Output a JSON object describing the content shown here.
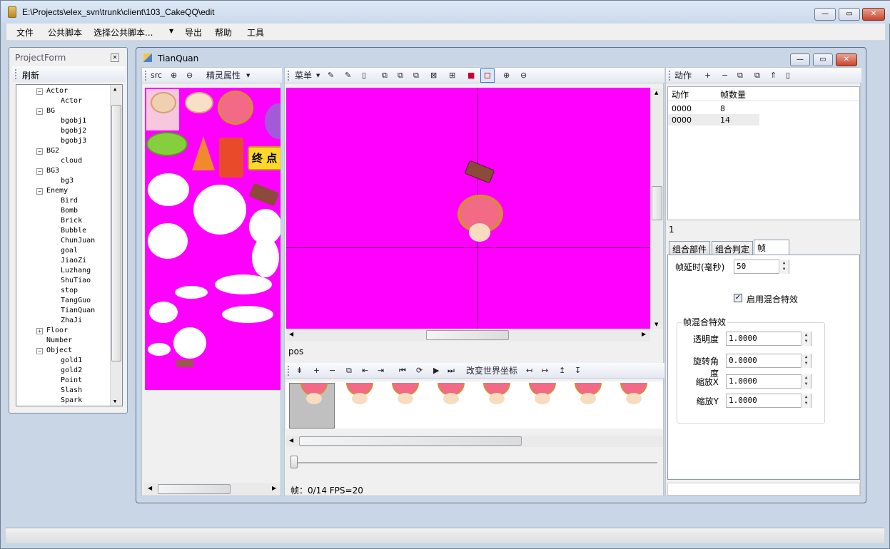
{
  "window": {
    "title": "E:\\Projects\\elex_svn\\trunk\\client\\103_CakeQQ\\edit"
  },
  "menu": {
    "items": [
      "文件",
      "公共脚本",
      "选择公共脚本...",
      "导出",
      "帮助",
      "工具"
    ]
  },
  "project": {
    "title": "ProjectForm",
    "refresh": "刷新",
    "tree": [
      {
        "label": "Actor",
        "level": 1,
        "expanded": true
      },
      {
        "label": "Actor",
        "level": 2
      },
      {
        "label": "BG",
        "level": 1,
        "expanded": true
      },
      {
        "label": "bgobj1",
        "level": 2
      },
      {
        "label": "bgobj2",
        "level": 2
      },
      {
        "label": "bgobj3",
        "level": 2
      },
      {
        "label": "BG2",
        "level": 1,
        "expanded": true
      },
      {
        "label": "cloud",
        "level": 2
      },
      {
        "label": "BG3",
        "level": 1,
        "expanded": true
      },
      {
        "label": "bg3",
        "level": 2
      },
      {
        "label": "Enemy",
        "level": 1,
        "expanded": true
      },
      {
        "label": "Bird",
        "level": 2
      },
      {
        "label": "Bomb",
        "level": 2
      },
      {
        "label": "Brick",
        "level": 2
      },
      {
        "label": "Bubble",
        "level": 2
      },
      {
        "label": "ChunJuan",
        "level": 2
      },
      {
        "label": "goal",
        "level": 2
      },
      {
        "label": "JiaoZi",
        "level": 2
      },
      {
        "label": "Luzhang",
        "level": 2
      },
      {
        "label": "ShuTiao",
        "level": 2
      },
      {
        "label": "stop",
        "level": 2
      },
      {
        "label": "TangGuo",
        "level": 2
      },
      {
        "label": "TianQuan",
        "level": 2
      },
      {
        "label": "ZhaJi",
        "level": 2
      },
      {
        "label": "Floor",
        "level": 1,
        "expanded": false
      },
      {
        "label": "Number",
        "level": 1,
        "leaf": true
      },
      {
        "label": "Object",
        "level": 1,
        "expanded": true
      },
      {
        "label": "gold1",
        "level": 2
      },
      {
        "label": "gold2",
        "level": 2
      },
      {
        "label": "Point",
        "level": 2
      },
      {
        "label": "Slash",
        "level": 2
      },
      {
        "label": "Spark",
        "level": 2
      }
    ]
  },
  "editor": {
    "title": "TianQuan",
    "src_toolbar": {
      "src": "src",
      "props": "精灵属性"
    },
    "canvas_toolbar": {
      "menu": "菜单"
    },
    "pos_label": "pos",
    "frame_toolbar": {
      "world_coord": "改变世界坐标"
    },
    "status": "帧：0/14 FPS=20"
  },
  "actions": {
    "toolbar_label": "动作",
    "columns": [
      "动作",
      "帧数量"
    ],
    "rows": [
      [
        "0000",
        "8"
      ],
      [
        "0000",
        "14"
      ]
    ],
    "footer": "1"
  },
  "props": {
    "tabs": [
      "组合部件",
      "组合判定",
      "帧"
    ],
    "delay_label": "帧延时(毫秒)",
    "delay_value": "50",
    "blend_checkbox": "启用混合特效",
    "group_title": "帧混合特效",
    "fields": [
      {
        "label": "透明度",
        "value": "1.0000"
      },
      {
        "label": "旋转角度",
        "value": "0.0000"
      },
      {
        "label": "缩放X",
        "value": "1.0000"
      },
      {
        "label": "缩放Y",
        "value": "1.0000"
      }
    ]
  },
  "colors": {
    "canvas": "#ff00ff",
    "frame_bg": "#c0c0c0"
  }
}
